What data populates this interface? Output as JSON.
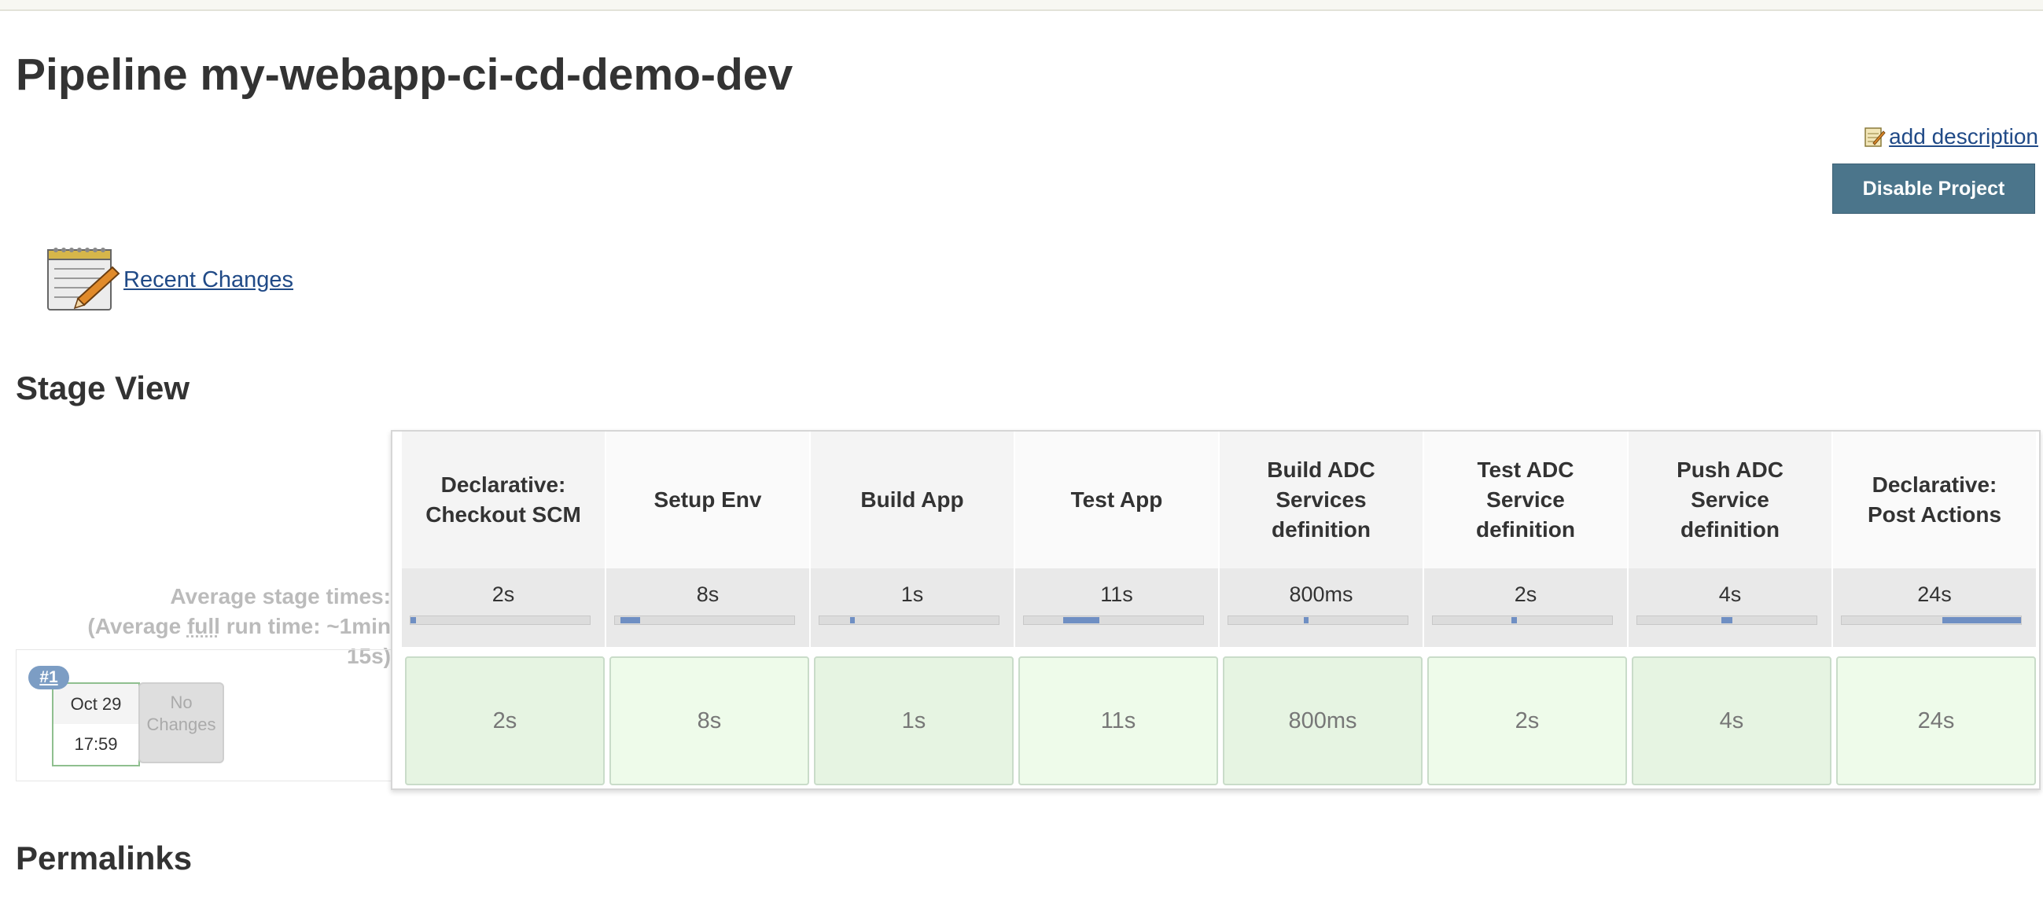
{
  "page": {
    "title": "Pipeline my-webapp-ci-cd-demo-dev",
    "add_description": "add description",
    "disable_button": "Disable Project",
    "recent_changes": "Recent Changes"
  },
  "stage_view": {
    "heading": "Stage View",
    "avg_label_line1": "Average stage times:",
    "avg_label_line2a": "(Average ",
    "avg_label_full": "full",
    "avg_label_line2b": " run time: ~1min",
    "avg_label_line3": "15s)",
    "stages": [
      {
        "name_lines": [
          "Declarative:",
          "Checkout SCM"
        ],
        "avg": "2s",
        "cell": "2s",
        "bar_start": 0.0,
        "bar_share": 0.03,
        "cell_color": "#e6f4e2"
      },
      {
        "name_lines": [
          "Setup Env"
        ],
        "avg": "8s",
        "cell": "8s",
        "bar_start": 0.03,
        "bar_share": 0.11,
        "cell_color": "#eefbea"
      },
      {
        "name_lines": [
          "Build App"
        ],
        "avg": "1s",
        "cell": "1s",
        "bar_start": 0.17,
        "bar_share": 0.02,
        "cell_color": "#e6f4e2"
      },
      {
        "name_lines": [
          "Test App"
        ],
        "avg": "11s",
        "cell": "11s",
        "bar_start": 0.22,
        "bar_share": 0.2,
        "cell_color": "#eefbea"
      },
      {
        "name_lines": [
          "Build ADC",
          "Services",
          "definition"
        ],
        "avg": "800ms",
        "cell": "800ms",
        "bar_start": 0.42,
        "bar_share": 0.01,
        "cell_color": "#e6f4e2"
      },
      {
        "name_lines": [
          "Test ADC",
          "Service",
          "definition"
        ],
        "avg": "2s",
        "cell": "2s",
        "bar_start": 0.44,
        "bar_share": 0.03,
        "cell_color": "#eefbea"
      },
      {
        "name_lines": [
          "Push ADC",
          "Service",
          "definition"
        ],
        "avg": "4s",
        "cell": "4s",
        "bar_start": 0.47,
        "bar_share": 0.06,
        "cell_color": "#e6f4e2"
      },
      {
        "name_lines": [
          "Declarative:",
          "Post Actions"
        ],
        "avg": "24s",
        "cell": "24s",
        "bar_start": 0.56,
        "bar_share": 0.44,
        "cell_color": "#eefbea"
      }
    ],
    "run": {
      "badge": "#1",
      "date": "Oct 29",
      "time": "17:59",
      "changes_line1": "No",
      "changes_line2": "Changes"
    }
  },
  "permalinks": {
    "heading": "Permalinks"
  },
  "colors": {
    "accent": "#4b758b",
    "link": "#204a87",
    "success_border": "#c9dcc9",
    "bar": "#6f8fc3"
  }
}
